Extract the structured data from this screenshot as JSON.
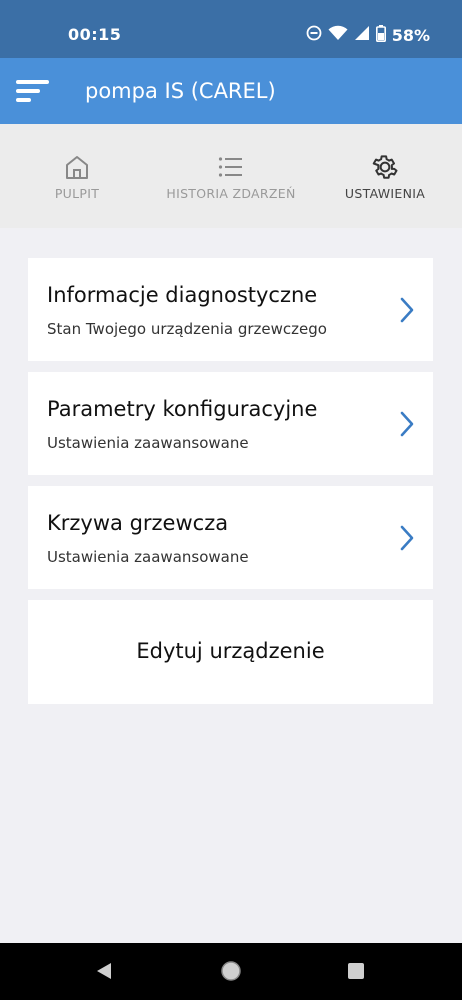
{
  "status_bar": {
    "time": "00:15",
    "battery_percent": "58%",
    "icons": [
      "do-not-disturb-icon",
      "wifi-icon",
      "cellular-signal-icon",
      "battery-icon"
    ]
  },
  "app_bar": {
    "title": "pompa IS (CAREL)",
    "background_color": "#4a90d9"
  },
  "tabs": [
    {
      "label": "PULPIT",
      "icon": "home-icon",
      "active": false
    },
    {
      "label": "HISTORIA ZDARZEŃ",
      "icon": "list-icon",
      "active": false
    },
    {
      "label": "USTAWIENIA",
      "icon": "gear-icon",
      "active": true
    }
  ],
  "menu_items": [
    {
      "title": "Informacje diagnostyczne",
      "subtitle": "Stan Twojego urządzenia grzewczego"
    },
    {
      "title": "Parametry konfiguracyjne",
      "subtitle": "Ustawienia zaawansowane"
    },
    {
      "title": "Krzywa grzewcza",
      "subtitle": "Ustawienia zaawansowane"
    }
  ],
  "edit_button": {
    "label": "Edytuj urządzenie"
  },
  "colors": {
    "accent": "#4a90d9",
    "status_bar": "#3b6fa6",
    "chevron": "#3a7cc4"
  }
}
